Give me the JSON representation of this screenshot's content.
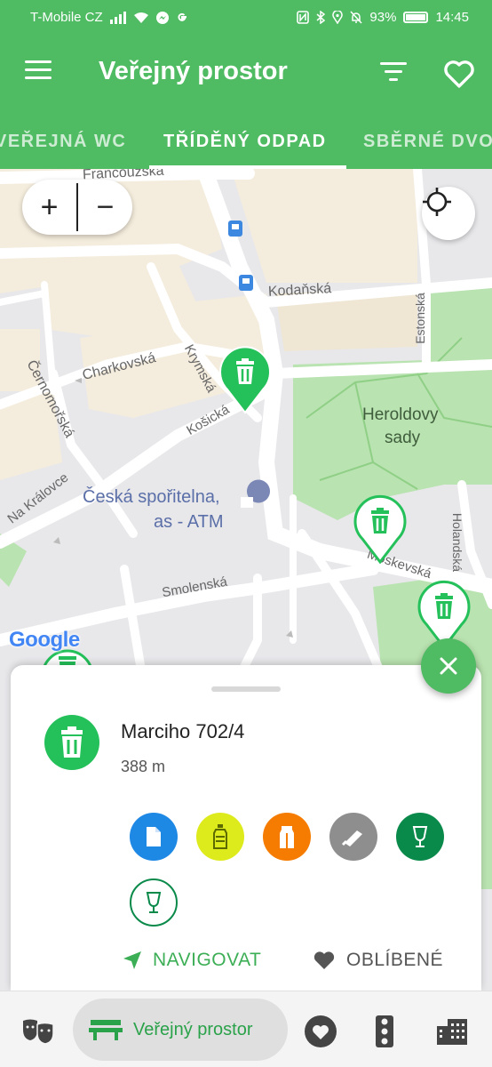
{
  "status_bar": {
    "carrier": "T-Mobile CZ",
    "battery": "93%",
    "time": "14:45"
  },
  "app_bar": {
    "title": "Veřejný prostor"
  },
  "tabs": [
    {
      "label": "VEŘEJNÁ WC",
      "active": false
    },
    {
      "label": "TŘÍDĚNÝ ODPAD",
      "active": true
    },
    {
      "label": "SBĚRNÉ DVO",
      "active": false
    }
  ],
  "map": {
    "zoom_in": "+",
    "zoom_out": "−",
    "attribution": "Google",
    "labels": {
      "francouzska": "Francouzska",
      "kodanska": "Kodaňská",
      "estonska": "Estonská",
      "cernomorska": "Černomořská",
      "charkovska": "Charkovská",
      "krymska": "Krymská",
      "kosicka": "Košická",
      "heroldovy": "Heroldovy",
      "sady": "sady",
      "na_kralovce": "Na Královce",
      "bank1": "Česká spořitelna,",
      "bank2": "as - ATM",
      "holandska": "Holandská",
      "moskevska": "Moskevská",
      "smolenska": "Smolenská"
    }
  },
  "detail": {
    "address": "Marciho 702/4",
    "distance": "388 m",
    "waste_types": [
      {
        "name": "paper",
        "icon": "paper-icon",
        "color": "#1e88e5"
      },
      {
        "name": "plastic",
        "icon": "bottle-icon",
        "color": "#ddea1c"
      },
      {
        "name": "beverage-carton",
        "icon": "carton-icon",
        "color": "#f57c00"
      },
      {
        "name": "metal",
        "icon": "can-icon",
        "color": "#8e8e8e"
      },
      {
        "name": "colored-glass",
        "icon": "glass-icon",
        "color": "#0a8a4a"
      },
      {
        "name": "clear-glass",
        "icon": "glass-icon",
        "color": "#ffffff"
      }
    ],
    "navigate_label": "NAVIGOVAT",
    "favorite_label": "OBLÍBENÉ"
  },
  "bottom_nav": {
    "active_label": "Veřejný prostor"
  },
  "colors": {
    "primary": "#4fbb62",
    "pin_green": "#24c05a",
    "park": "#b9e3b0"
  }
}
